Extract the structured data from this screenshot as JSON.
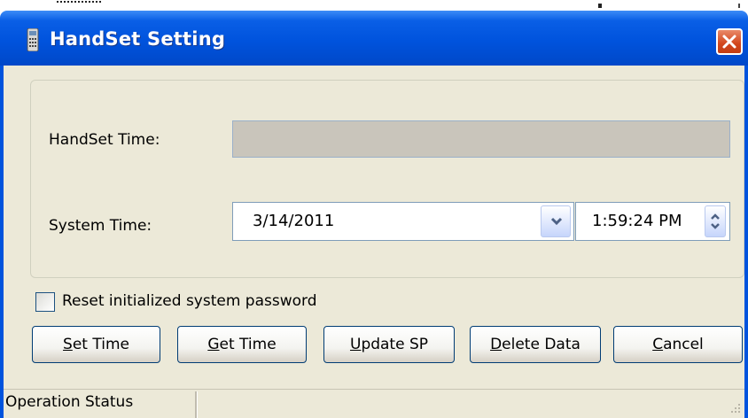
{
  "window": {
    "title": "HandSet Setting",
    "title_icon": "handset-icon",
    "close_icon": "close-icon"
  },
  "fields": {
    "handset_time_label": "HandSet Time:",
    "handset_time_value": "",
    "system_time_label": "System Time:",
    "system_date_value": "3/14/2011",
    "system_time_value": "1:59:24 PM"
  },
  "checkbox": {
    "label": "Reset initialized system password",
    "checked": false
  },
  "buttons": {
    "set_time": {
      "mnemonic": "S",
      "rest": "et Time"
    },
    "get_time": {
      "mnemonic": "G",
      "rest": "et Time"
    },
    "update_sp": {
      "mnemonic": "U",
      "rest": "pdate SP"
    },
    "delete_data": {
      "mnemonic": "D",
      "rest": "elete Data"
    },
    "cancel": {
      "mnemonic": "C",
      "rest": "ancel"
    }
  },
  "statusbar": {
    "text": "Operation Status"
  },
  "colors": {
    "titlebar": "#0053dd",
    "dialog_bg": "#ece9d8",
    "close_button": "#d2461c",
    "readonly_field": "#c9c5bb"
  }
}
